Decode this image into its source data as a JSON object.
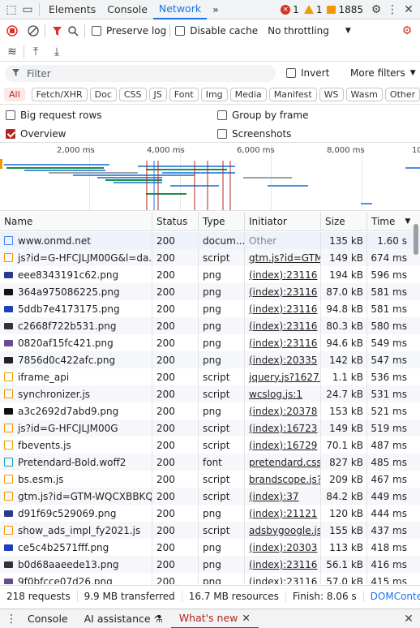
{
  "topbar": {
    "tabs": [
      "Elements",
      "Console",
      "Network"
    ],
    "active_tab": "Network",
    "more_tabs": "»",
    "errors": "1",
    "warnings": "1",
    "issues": "1885"
  },
  "toolbar": {
    "preserve_log": "Preserve log",
    "disable_cache": "Disable cache",
    "throttling": "No throttling"
  },
  "filter": {
    "placeholder": "Filter",
    "invert": "Invert",
    "more_filters": "More filters"
  },
  "types": [
    "All",
    "Fetch/XHR",
    "Doc",
    "CSS",
    "JS",
    "Font",
    "Img",
    "Media",
    "Manifest",
    "WS",
    "Wasm",
    "Other"
  ],
  "options": {
    "big_request_rows": "Big request rows",
    "group_by_frame": "Group by frame",
    "overview": "Overview",
    "screenshots": "Screenshots"
  },
  "overview": {
    "ticks": [
      "2,000 ms",
      "4,000 ms",
      "6,000 ms",
      "8,000 ms",
      "10"
    ]
  },
  "columns": {
    "name": "Name",
    "status": "Status",
    "type": "Type",
    "initiator": "Initiator",
    "size": "Size",
    "time": "Time"
  },
  "rows": [
    {
      "name": "www.onmd.net",
      "status": "200",
      "type": "docum...",
      "initiator": "Other",
      "size": "135 kB",
      "time": "1.60 s",
      "icon": "document-icon"
    },
    {
      "name": "js?id=G-HFCJLJM00G&l=da...",
      "status": "200",
      "type": "script",
      "initiator": "gtm.js?id=GTM-V",
      "size": "149 kB",
      "time": "674 ms",
      "icon": "script-icon"
    },
    {
      "name": "eee8343191c62.png",
      "status": "200",
      "type": "png",
      "initiator": "(index):23116",
      "size": "194 kB",
      "time": "596 ms",
      "icon": "image-icon"
    },
    {
      "name": "364a975086225.png",
      "status": "200",
      "type": "png",
      "initiator": "(index):23116",
      "size": "87.0 kB",
      "time": "581 ms",
      "icon": "image-icon"
    },
    {
      "name": "5ddb7e4173175.png",
      "status": "200",
      "type": "png",
      "initiator": "(index):23116",
      "size": "94.8 kB",
      "time": "581 ms",
      "icon": "image-icon"
    },
    {
      "name": "c2668f722b531.png",
      "status": "200",
      "type": "png",
      "initiator": "(index):23116",
      "size": "80.3 kB",
      "time": "580 ms",
      "icon": "image-icon"
    },
    {
      "name": "0820af15fc421.png",
      "status": "200",
      "type": "png",
      "initiator": "(index):23116",
      "size": "94.6 kB",
      "time": "549 ms",
      "icon": "image-icon"
    },
    {
      "name": "7856d0c422afc.png",
      "status": "200",
      "type": "png",
      "initiator": "(index):20335",
      "size": "142 kB",
      "time": "547 ms",
      "icon": "image-icon"
    },
    {
      "name": "iframe_api",
      "status": "200",
      "type": "script",
      "initiator": "jquery.js?162751",
      "size": "1.1 kB",
      "time": "536 ms",
      "icon": "script-icon"
    },
    {
      "name": "synchronizer.js",
      "status": "200",
      "type": "script",
      "initiator": "wcslog.js:1",
      "size": "24.7 kB",
      "time": "531 ms",
      "icon": "script-icon"
    },
    {
      "name": "a3c2692d7abd9.png",
      "status": "200",
      "type": "png",
      "initiator": "(index):20378",
      "size": "153 kB",
      "time": "521 ms",
      "icon": "image-icon"
    },
    {
      "name": "js?id=G-HFCJLJM00G",
      "status": "200",
      "type": "script",
      "initiator": "(index):16723",
      "size": "149 kB",
      "time": "519 ms",
      "icon": "script-icon"
    },
    {
      "name": "fbevents.js",
      "status": "200",
      "type": "script",
      "initiator": "(index):16729",
      "size": "70.1 kB",
      "time": "487 ms",
      "icon": "script-icon"
    },
    {
      "name": "Pretendard-Bold.woff2",
      "status": "200",
      "type": "font",
      "initiator": "pretendard.css",
      "size": "827 kB",
      "time": "485 ms",
      "icon": "font-icon"
    },
    {
      "name": "bs.esm.js",
      "status": "200",
      "type": "script",
      "initiator": "brandscope.js?17",
      "size": "209 kB",
      "time": "467 ms",
      "icon": "script-icon"
    },
    {
      "name": "gtm.js?id=GTM-WQCXBBKQ",
      "status": "200",
      "type": "script",
      "initiator": "(index):37",
      "size": "84.2 kB",
      "time": "449 ms",
      "icon": "script-icon"
    },
    {
      "name": "d91f69c529069.png",
      "status": "200",
      "type": "png",
      "initiator": "(index):21121",
      "size": "120 kB",
      "time": "444 ms",
      "icon": "image-icon"
    },
    {
      "name": "show_ads_impl_fy2021.js",
      "status": "200",
      "type": "script",
      "initiator": "adsbygoogle.js?c",
      "size": "155 kB",
      "time": "437 ms",
      "icon": "script-icon"
    },
    {
      "name": "ce5c4b2571fff.png",
      "status": "200",
      "type": "png",
      "initiator": "(index):20303",
      "size": "113 kB",
      "time": "418 ms",
      "icon": "image-icon"
    },
    {
      "name": "b0d68aaeede13.png",
      "status": "200",
      "type": "png",
      "initiator": "(index):23116",
      "size": "56.1 kB",
      "time": "416 ms",
      "icon": "image-icon"
    },
    {
      "name": "9f0bfcce07d26.png",
      "status": "200",
      "type": "png",
      "initiator": "(index):23116",
      "size": "57.0 kB",
      "time": "415 ms",
      "icon": "image-icon"
    }
  ],
  "statusbar": {
    "requests": "218 requests",
    "transferred": "9.9 MB transferred",
    "resources": "16.7 MB resources",
    "finish": "Finish: 8.06 s",
    "dcl": "DOMContentLoa"
  },
  "drawer": {
    "tabs": [
      "Console",
      "AI assistance",
      "What's new"
    ],
    "active_tab": "What's new"
  },
  "colors": {
    "accent_blue": "#1a73e8",
    "active_red": "#b3261e"
  }
}
